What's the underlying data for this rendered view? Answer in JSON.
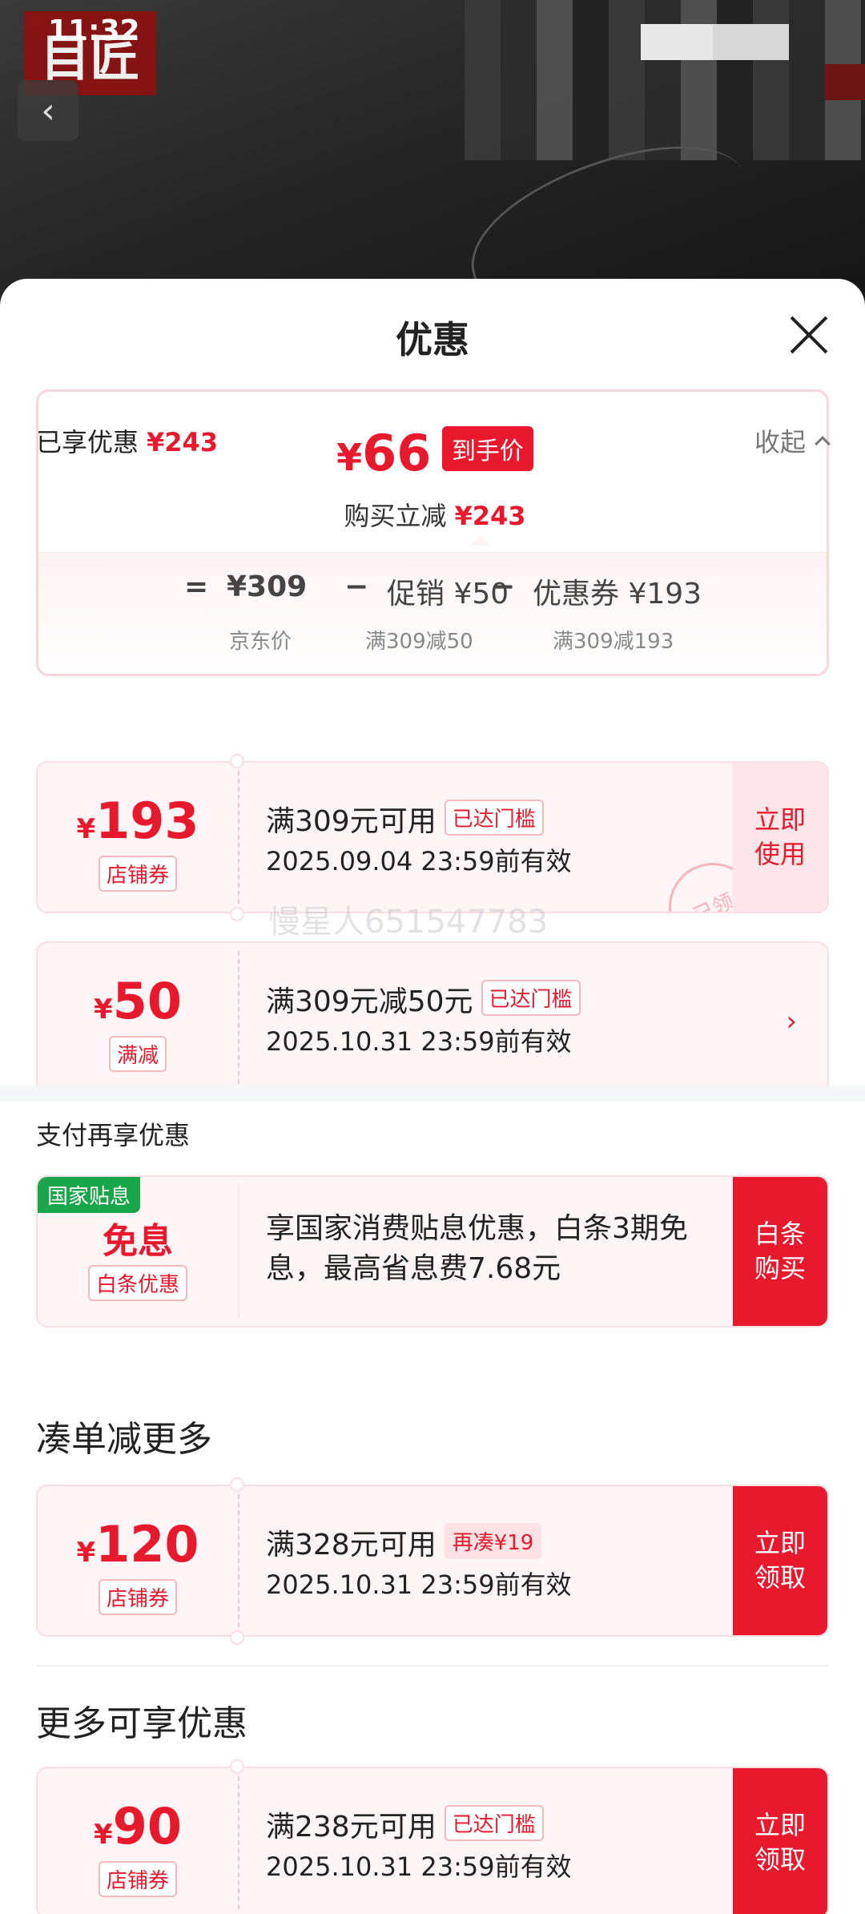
{
  "status_bar": {
    "time": "11:32"
  },
  "backdrop": {
    "logo_text": "目匠"
  },
  "sheet": {
    "title": "优惠"
  },
  "summary": {
    "currency": "¥",
    "final_price": "66",
    "final_tag": "到手价",
    "reduce_label": "购买立减",
    "reduce_amount": "¥243",
    "formula": {
      "equals": "=",
      "minus": "−",
      "jd_price": "¥309",
      "jd_price_label": "京东价",
      "promo": "促销 ¥50",
      "promo_rule": "满309减50",
      "coupon": "优惠券 ¥193",
      "coupon_rule": "满309减193"
    }
  },
  "enjoyed": {
    "label": "已享优惠",
    "amount": "¥243",
    "collapse": "收起"
  },
  "coupons_enjoyed": [
    {
      "yen": "¥",
      "amount": "193",
      "type": "店铺券",
      "cond": "满309元可用",
      "badge": "已达门槛",
      "expire": "2025.09.04 23:59前有效",
      "action": "立即\n使用",
      "stamp": "已领"
    },
    {
      "yen": "¥",
      "amount": "50",
      "type": "满减",
      "cond": "满309元减50元",
      "badge": "已达门槛",
      "expire": "2025.10.31 23:59前有效",
      "arrow": "›"
    }
  ],
  "watermark": "慢星人651547783",
  "pay_section": {
    "label": "支付再享优惠",
    "flag": "国家贴息",
    "title": "免息",
    "type": "白条优惠",
    "desc": "享国家消费贴息优惠，白条3期免息，最高省息费7.68元",
    "action": "白条\n购买"
  },
  "more_order": {
    "label": "凑单减更多",
    "coupon": {
      "yen": "¥",
      "amount": "120",
      "type": "店铺券",
      "cond": "满328元可用",
      "badge": "再凑¥19",
      "expire": "2025.10.31 23:59前有效",
      "action": "立即\n领取"
    }
  },
  "more_offers": {
    "label": "更多可享优惠",
    "coupon": {
      "yen": "¥",
      "amount": "90",
      "type": "店铺券",
      "cond": "满238元可用",
      "badge": "已达门槛",
      "expire": "2025.10.31 23:59前有效",
      "action": "立即\n领取"
    }
  },
  "colors": {
    "accent": "#e8192c",
    "flag_green": "#19a54a"
  }
}
